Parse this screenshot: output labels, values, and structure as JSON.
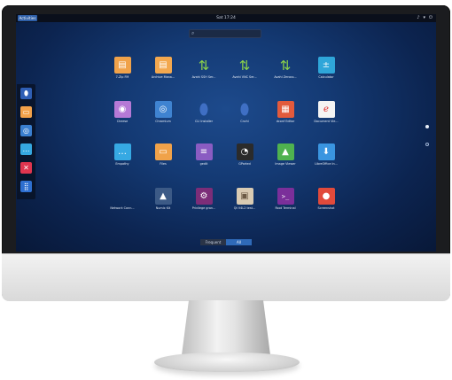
{
  "topbar": {
    "activities_label": "Activities",
    "clock": "Sat 17:24",
    "tray_icons": [
      "volume-icon",
      "network-icon",
      "power-icon"
    ]
  },
  "search": {
    "placeholder": ""
  },
  "dock": {
    "items": [
      {
        "name": "dock-item-cli-installer",
        "icon": "droplet-icon",
        "color": "#2f5fb5"
      },
      {
        "name": "dock-item-files",
        "icon": "folder-icon",
        "color": "#f2a14a"
      },
      {
        "name": "dock-item-chromium",
        "icon": "chromium-icon",
        "color": "#3a7fd0"
      },
      {
        "name": "dock-item-empathy",
        "icon": "chat-icon",
        "color": "#35a7e0"
      },
      {
        "name": "dock-item-tools",
        "icon": "x-icon",
        "color": "#e0354f"
      },
      {
        "name": "dock-item-show-apps",
        "icon": "grid-icon",
        "color": "#2e6fd0"
      }
    ]
  },
  "apps": [
    {
      "label": "7-Zip FM",
      "icon": "archive-icon",
      "color": "#f0a24a",
      "glyph": "▤"
    },
    {
      "label": "Archive Mana...",
      "icon": "archive-manager-icon",
      "color": "#f3a84f",
      "glyph": "▤"
    },
    {
      "label": "Avahi SSH Ser...",
      "icon": "updown-arrows-icon",
      "color": "transparent",
      "glyph": "⇅"
    },
    {
      "label": "Avahi VNC Ser...",
      "icon": "updown-arrows-icon",
      "color": "transparent",
      "glyph": "⇅"
    },
    {
      "label": "Avahi Zeroco...",
      "icon": "updown-arrows-icon",
      "color": "transparent",
      "glyph": "⇅"
    },
    {
      "label": "Calculator",
      "icon": "calculator-icon",
      "color": "#2fa6d9",
      "glyph": "±"
    },
    {
      "label": "Cheese",
      "icon": "webcam-icon",
      "color": "#b679d6",
      "glyph": "◉"
    },
    {
      "label": "Chromium",
      "icon": "chromium-icon",
      "color": "#3f83d1",
      "glyph": "◎"
    },
    {
      "label": "CLI Installer",
      "icon": "droplet-icon",
      "color": "transparent",
      "glyph": "⬮"
    },
    {
      "label": "Cnchi",
      "icon": "droplet-icon",
      "color": "transparent",
      "glyph": "⬮"
    },
    {
      "label": "dconf Editor",
      "icon": "dconf-icon",
      "color": "#e25a3c",
      "glyph": "▦"
    },
    {
      "label": "Document Vie...",
      "icon": "document-viewer-icon",
      "color": "#f4f4f4",
      "glyph": "e"
    },
    {
      "label": "Empathy",
      "icon": "chat-icon",
      "color": "#36a9e3",
      "glyph": "…"
    },
    {
      "label": "Files",
      "icon": "folder-icon",
      "color": "#f0a24a",
      "glyph": "▭"
    },
    {
      "label": "gedit",
      "icon": "text-editor-icon",
      "color": "#8a5cc2",
      "glyph": "≡"
    },
    {
      "label": "GParted",
      "icon": "disk-icon",
      "color": "#2b2b2b",
      "glyph": "◔"
    },
    {
      "label": "Image Viewer",
      "icon": "image-icon",
      "color": "#4fb24f",
      "glyph": "▲"
    },
    {
      "label": "LibreOffice In...",
      "icon": "download-icon",
      "color": "#3a95e0",
      "glyph": "⬇"
    },
    {
      "label": "Network Conn...",
      "icon": "network-icon",
      "color": "transparent",
      "glyph": ""
    },
    {
      "label": "Numix Kit",
      "icon": "numix-icon",
      "color": "#3c5a86",
      "glyph": "▲"
    },
    {
      "label": "Privilege gran...",
      "icon": "gear-icon",
      "color": "#7c2d78",
      "glyph": "⚙"
    },
    {
      "label": "Qt V4L2 test...",
      "icon": "webcam-test-icon",
      "color": "#d9cbb3",
      "glyph": "▣"
    },
    {
      "label": "Root Terminal",
      "icon": "terminal-icon",
      "color": "#7b2f9a",
      "glyph": ">_"
    },
    {
      "label": "Screenshot",
      "icon": "screenshot-icon",
      "color": "#e14a3b",
      "glyph": "●"
    }
  ],
  "view_tabs": {
    "frequent": "Frequent",
    "all": "All"
  },
  "pager": {
    "active": 1,
    "count": 2
  }
}
